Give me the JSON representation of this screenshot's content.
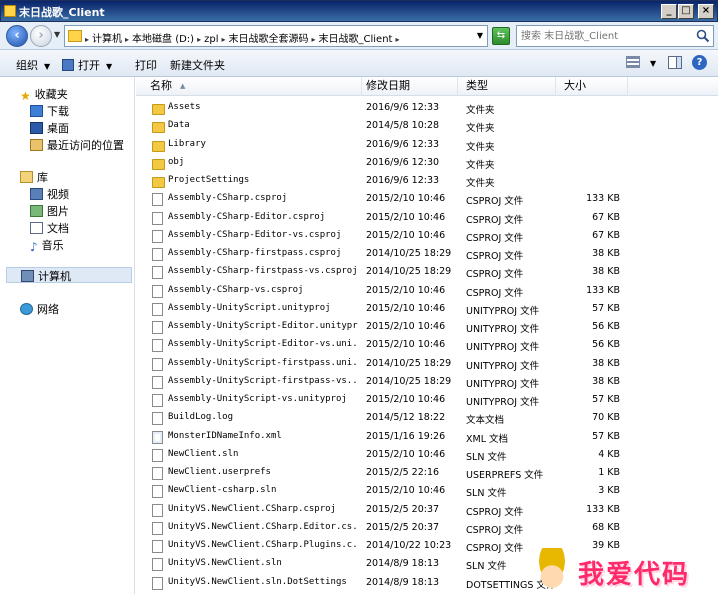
{
  "window": {
    "title": "末日战歌_Client"
  },
  "address": {
    "crumbs": [
      "计算机",
      "本地磁盘 (D:)",
      "zpl",
      "末日战歌全套源码",
      "末日战歌_Client"
    ],
    "search_placeholder": "搜索 末日战歌_Client"
  },
  "toolbar": {
    "organize": "组织",
    "open": "打开",
    "print": "打印",
    "new_folder": "新建文件夹"
  },
  "sidebar": {
    "favorites": "收藏夹",
    "downloads": "下载",
    "desktop": "桌面",
    "recent": "最近访问的位置",
    "libraries": "库",
    "videos": "视频",
    "pictures": "图片",
    "documents": "文档",
    "music": "音乐",
    "computer": "计算机",
    "network": "网络"
  },
  "columns": {
    "name": "名称",
    "date": "修改日期",
    "type": "类型",
    "size": "大小"
  },
  "files": [
    {
      "name": "Assets",
      "date": "2016/9/6 12:33",
      "type": "文件夹",
      "size": "",
      "kind": "folder"
    },
    {
      "name": "Data",
      "date": "2014/5/8 10:28",
      "type": "文件夹",
      "size": "",
      "kind": "folder"
    },
    {
      "name": "Library",
      "date": "2016/9/6 12:33",
      "type": "文件夹",
      "size": "",
      "kind": "folder"
    },
    {
      "name": "obj",
      "date": "2016/9/6 12:30",
      "type": "文件夹",
      "size": "",
      "kind": "folder"
    },
    {
      "name": "ProjectSettings",
      "date": "2016/9/6 12:33",
      "type": "文件夹",
      "size": "",
      "kind": "folder"
    },
    {
      "name": "Assembly-CSharp.csproj",
      "date": "2015/2/10 10:46",
      "type": "CSPROJ 文件",
      "size": "133 KB",
      "kind": "file"
    },
    {
      "name": "Assembly-CSharp-Editor.csproj",
      "date": "2015/2/10 10:46",
      "type": "CSPROJ 文件",
      "size": "67 KB",
      "kind": "file"
    },
    {
      "name": "Assembly-CSharp-Editor-vs.csproj",
      "date": "2015/2/10 10:46",
      "type": "CSPROJ 文件",
      "size": "67 KB",
      "kind": "file"
    },
    {
      "name": "Assembly-CSharp-firstpass.csproj",
      "date": "2014/10/25 18:29",
      "type": "CSPROJ 文件",
      "size": "38 KB",
      "kind": "file"
    },
    {
      "name": "Assembly-CSharp-firstpass-vs.csproj",
      "date": "2014/10/25 18:29",
      "type": "CSPROJ 文件",
      "size": "38 KB",
      "kind": "file"
    },
    {
      "name": "Assembly-CSharp-vs.csproj",
      "date": "2015/2/10 10:46",
      "type": "CSPROJ 文件",
      "size": "133 KB",
      "kind": "file"
    },
    {
      "name": "Assembly-UnityScript.unityproj",
      "date": "2015/2/10 10:46",
      "type": "UNITYPROJ 文件",
      "size": "57 KB",
      "kind": "file"
    },
    {
      "name": "Assembly-UnityScript-Editor.unityproj",
      "date": "2015/2/10 10:46",
      "type": "UNITYPROJ 文件",
      "size": "56 KB",
      "kind": "file"
    },
    {
      "name": "Assembly-UnityScript-Editor-vs.uni...",
      "date": "2015/2/10 10:46",
      "type": "UNITYPROJ 文件",
      "size": "56 KB",
      "kind": "file"
    },
    {
      "name": "Assembly-UnityScript-firstpass.uni...",
      "date": "2014/10/25 18:29",
      "type": "UNITYPROJ 文件",
      "size": "38 KB",
      "kind": "file"
    },
    {
      "name": "Assembly-UnityScript-firstpass-vs....",
      "date": "2014/10/25 18:29",
      "type": "UNITYPROJ 文件",
      "size": "38 KB",
      "kind": "file"
    },
    {
      "name": "Assembly-UnityScript-vs.unityproj",
      "date": "2015/2/10 10:46",
      "type": "UNITYPROJ 文件",
      "size": "57 KB",
      "kind": "file"
    },
    {
      "name": "BuildLog.log",
      "date": "2014/5/12 18:22",
      "type": "文本文档",
      "size": "70 KB",
      "kind": "file"
    },
    {
      "name": "MonsterIDNameInfo.xml",
      "date": "2015/1/16 19:26",
      "type": "XML 文档",
      "size": "57 KB",
      "kind": "xml"
    },
    {
      "name": "NewClient.sln",
      "date": "2015/2/10 10:46",
      "type": "SLN 文件",
      "size": "4 KB",
      "kind": "file"
    },
    {
      "name": "NewClient.userprefs",
      "date": "2015/2/5 22:16",
      "type": "USERPREFS 文件",
      "size": "1 KB",
      "kind": "file"
    },
    {
      "name": "NewClient-csharp.sln",
      "date": "2015/2/10 10:46",
      "type": "SLN 文件",
      "size": "3 KB",
      "kind": "file"
    },
    {
      "name": "UnityVS.NewClient.CSharp.csproj",
      "date": "2015/2/5 20:37",
      "type": "CSPROJ 文件",
      "size": "133 KB",
      "kind": "file"
    },
    {
      "name": "UnityVS.NewClient.CSharp.Editor.cs...",
      "date": "2015/2/5 20:37",
      "type": "CSPROJ 文件",
      "size": "68 KB",
      "kind": "file"
    },
    {
      "name": "UnityVS.NewClient.CSharp.Plugins.c...",
      "date": "2014/10/22 10:23",
      "type": "CSPROJ 文件",
      "size": "39 KB",
      "kind": "file"
    },
    {
      "name": "UnityVS.NewClient.sln",
      "date": "2014/8/9 18:13",
      "type": "SLN 文件",
      "size": "",
      "kind": "file"
    },
    {
      "name": "UnityVS.NewClient.sln.DotSettings",
      "date": "2014/8/9 18:13",
      "type": "DOTSETTINGS 文件",
      "size": "",
      "kind": "file"
    }
  ],
  "watermark": {
    "text": "我爱代码"
  }
}
